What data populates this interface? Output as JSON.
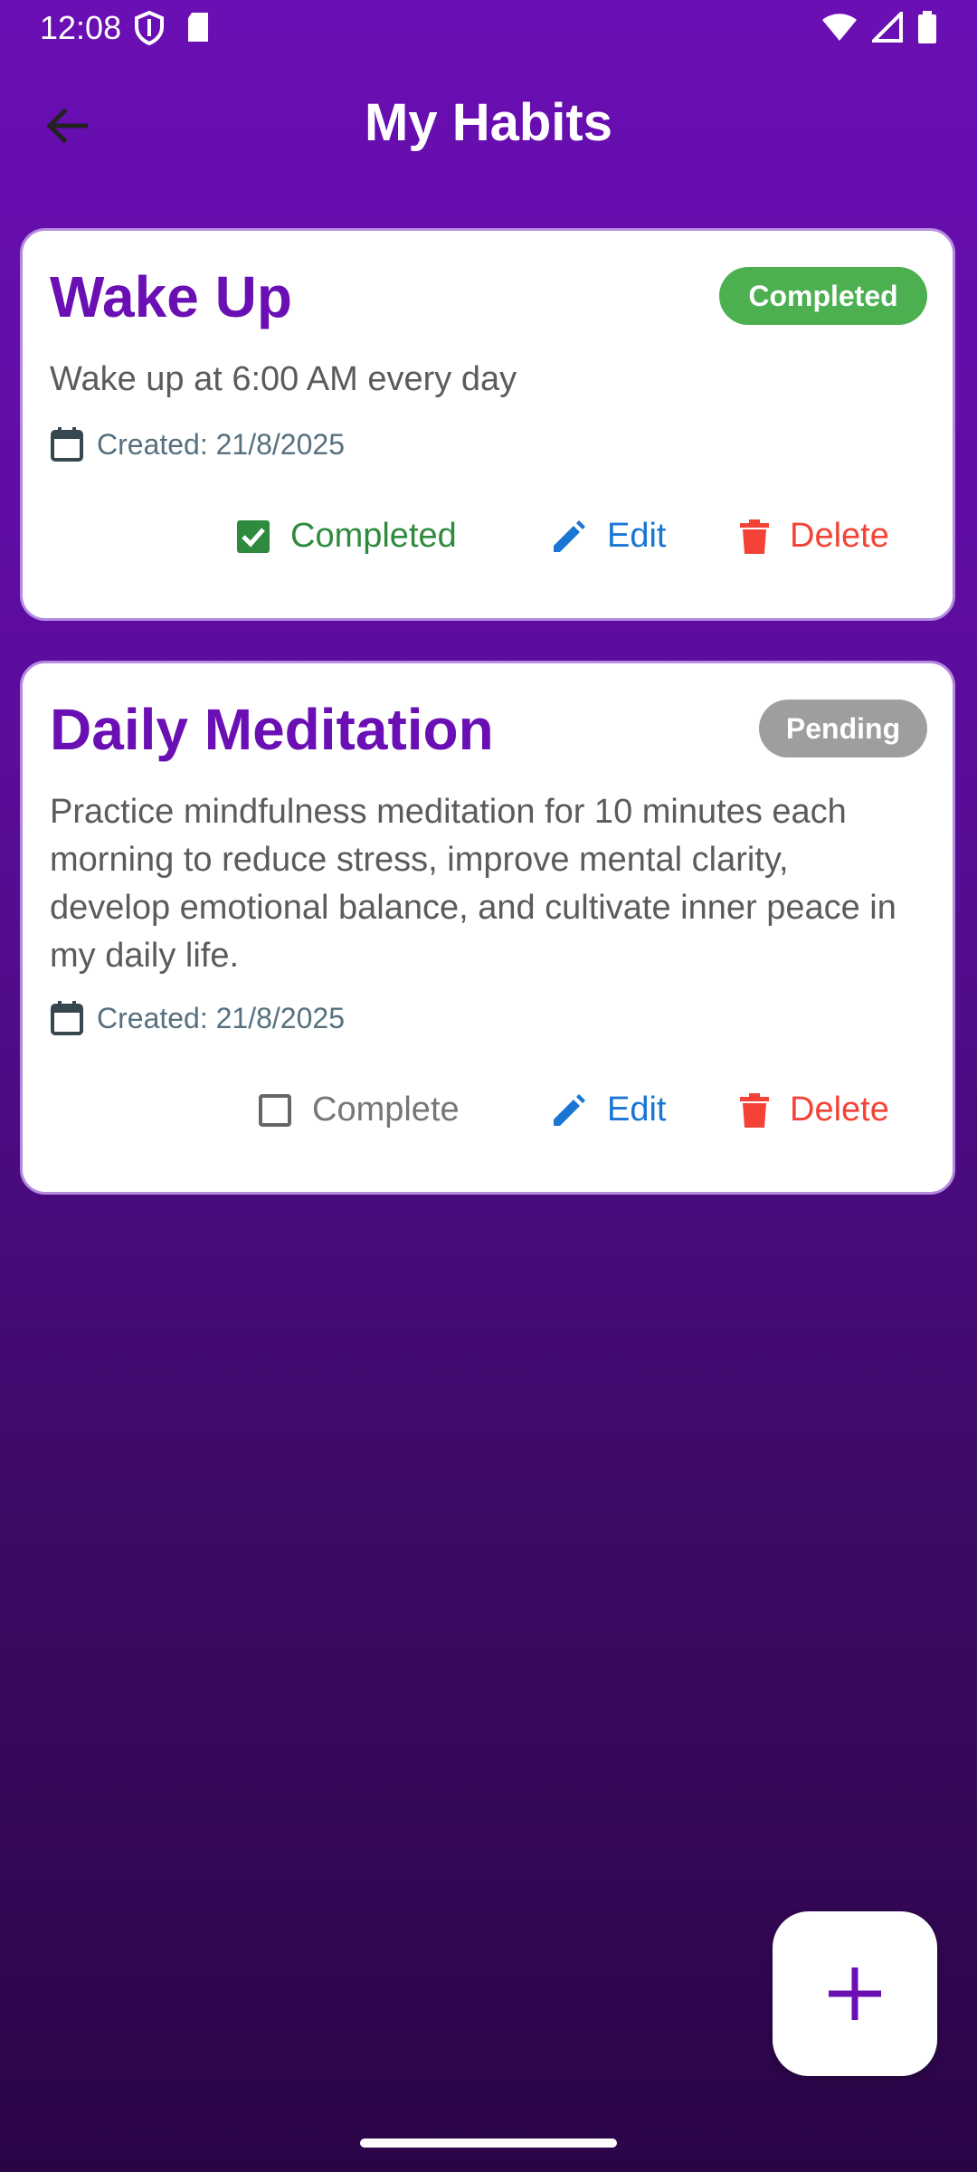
{
  "status_bar": {
    "time": "12:08"
  },
  "app_bar": {
    "title": "My Habits"
  },
  "habits": [
    {
      "title": "Wake Up",
      "status_badge": "Completed",
      "description": "Wake up at 6:00 AM every day",
      "created": "Created: 21/8/2025",
      "toggle_label": "Completed",
      "edit_label": "Edit",
      "delete_label": "Delete",
      "completed": true
    },
    {
      "title": "Daily Meditation",
      "status_badge": "Pending",
      "description": "Practice mindfulness meditation for 10 minutes each morning to reduce stress, improve mental clarity, develop emotional balance, and cultivate inner peace in my daily life.",
      "created": "Created: 21/8/2025",
      "toggle_label": "Complete",
      "edit_label": "Edit",
      "delete_label": "Delete",
      "completed": false
    }
  ],
  "colors": {
    "accent": "#6a0fb4",
    "completed_green": "#4caf50",
    "pending_grey": "#9e9e9e",
    "edit_blue": "#1976d2",
    "delete_red": "#f44336"
  },
  "icons": {
    "back": "arrow-left-icon",
    "calendar": "calendar-icon",
    "checkbox_checked": "checkbox-checked-icon",
    "checkbox_empty": "checkbox-empty-icon",
    "edit": "pencil-icon",
    "delete": "trash-icon",
    "add": "plus-icon"
  }
}
